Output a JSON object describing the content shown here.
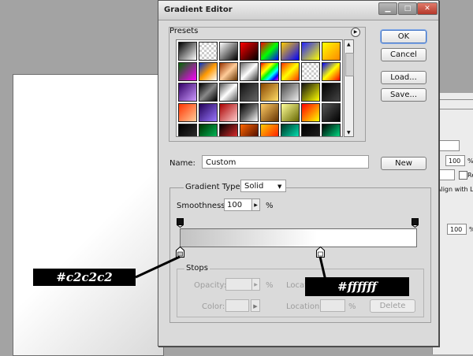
{
  "window": {
    "title": "Gradient Editor"
  },
  "presets": {
    "label": "Presets",
    "swatches": [
      "linear-gradient(135deg,#000,#fff)",
      "repeating-conic-gradient(#ccc 0 25%,#fff 0 50%) 0 0/6px 6px",
      "linear-gradient(135deg,#fff,#000)",
      "linear-gradient(135deg,#ff0000,#000)",
      "linear-gradient(135deg,#ff0000,#00ff00,#0000ff)",
      "linear-gradient(135deg,#ffcc00,#0000ff)",
      "linear-gradient(135deg,#2222ff,#ffff00)",
      "linear-gradient(135deg,#ffff00,#ff8800)",
      "linear-gradient(135deg,#006600,#ff00ff)",
      "linear-gradient(135deg,#0033cc,#ff9900,#ffffff)",
      "linear-gradient(135deg,#993300,#ffcc99,#663300)",
      "linear-gradient(135deg,#666,#fff,#333)",
      "linear-gradient(135deg,#ff0000,#ff9900,#ffff00,#00ff00,#00ffff,#0000ff,#ff00ff)",
      "linear-gradient(135deg,#ff3300,#ffff00,#ff3300)",
      "repeating-conic-gradient(#ccc 0 25%,#fff 0 50%) 0 0/6px 6px",
      "linear-gradient(135deg,#0000ff,#ffff00,#ff0000)",
      "linear-gradient(135deg,#330066,#cc99ff)",
      "linear-gradient(135deg,#000,#888,#000)",
      "linear-gradient(135deg,#555,#fff,#555)",
      "linear-gradient(135deg,#111,#666)",
      "linear-gradient(135deg,#884400,#ffdd66)",
      "linear-gradient(135deg,#444,#eee)",
      "linear-gradient(135deg,#111,#ffff00)",
      "linear-gradient(135deg,#000,#444)",
      "linear-gradient(135deg,#ff3300,#ffcc99)",
      "linear-gradient(135deg,#220055,#9977ff)",
      "linear-gradient(135deg,#aa0000,#ffcccc)",
      "linear-gradient(135deg,#000,#666,#fff)",
      "linear-gradient(135deg,#ffcc66,#663300)",
      "linear-gradient(135deg,#ffff99,#666600)",
      "linear-gradient(135deg,#ff0000,#ffff00)",
      "linear-gradient(135deg,#555,#000)",
      "linear-gradient(135deg,#000,#333)",
      "linear-gradient(135deg,#003300,#00cc66)",
      "linear-gradient(135deg,#000,#ff3333)",
      "linear-gradient(135deg,#ff6600,#330000)",
      "linear-gradient(135deg,#ffcc00,#ff0000)",
      "linear-gradient(135deg,#003322,#00ffcc)",
      "linear-gradient(135deg,#000,#222)",
      "linear-gradient(135deg,#000,#00ff99)"
    ],
    "menu_icon": "triangle-right-icon"
  },
  "buttons": {
    "ok": "OK",
    "cancel": "Cancel",
    "load": "Load...",
    "save": "Save...",
    "new": "New"
  },
  "name": {
    "label": "Name:",
    "value": "Custom"
  },
  "gradient": {
    "type_label": "Gradient Type:",
    "type_value": "Solid",
    "smoothness_label": "Smoothness:",
    "smoothness_value": "100",
    "smoothness_unit": "%",
    "start_color": "#c2c2c2",
    "end_color": "#ffffff"
  },
  "stops": {
    "label": "Stops",
    "opacity_label": "Opacity:",
    "opacity_unit": "%",
    "location_label": "Location:",
    "color_label": "Color:",
    "location_unit": "%",
    "delete_label": "Delete"
  },
  "annotations": {
    "left": "#c2c2c2",
    "right": "#ffffff"
  },
  "background_dialog": {
    "field1": "100",
    "unit1": "%",
    "field2": "100",
    "unit2": "%",
    "align_text": "Align with L",
    "checkbox_label": "Re"
  }
}
